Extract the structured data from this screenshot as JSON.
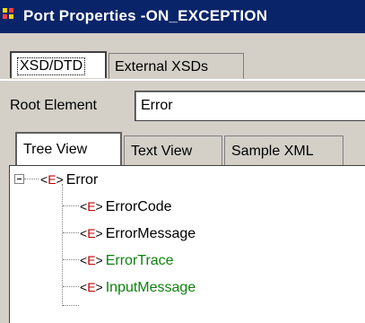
{
  "window": {
    "title": "Port Properties -ON_EXCEPTION"
  },
  "top_tabs": [
    {
      "label": "XSD/DTD",
      "active": true
    },
    {
      "label": "External XSDs",
      "active": false
    }
  ],
  "root_element": {
    "label": "Root Element",
    "value": "Error"
  },
  "view_tabs": [
    {
      "label": "Tree View",
      "active": true
    },
    {
      "label": "Text View",
      "active": false
    },
    {
      "label": "Sample XML",
      "active": false
    }
  ],
  "tree": {
    "tag_prefix": "<",
    "tag_letter": "E",
    "tag_suffix": ">",
    "root": {
      "label": "Error",
      "expanded": true
    },
    "children": [
      {
        "label": "ErrorCode",
        "color": "#000000"
      },
      {
        "label": "ErrorMessage",
        "color": "#000000"
      },
      {
        "label": "ErrorTrace",
        "color": "#108010"
      },
      {
        "label": "InputMessage",
        "color": "#108010"
      }
    ]
  },
  "colors": {
    "titlebar": "#0a246a",
    "tag_letter": "#c00000",
    "green_node": "#108010"
  }
}
